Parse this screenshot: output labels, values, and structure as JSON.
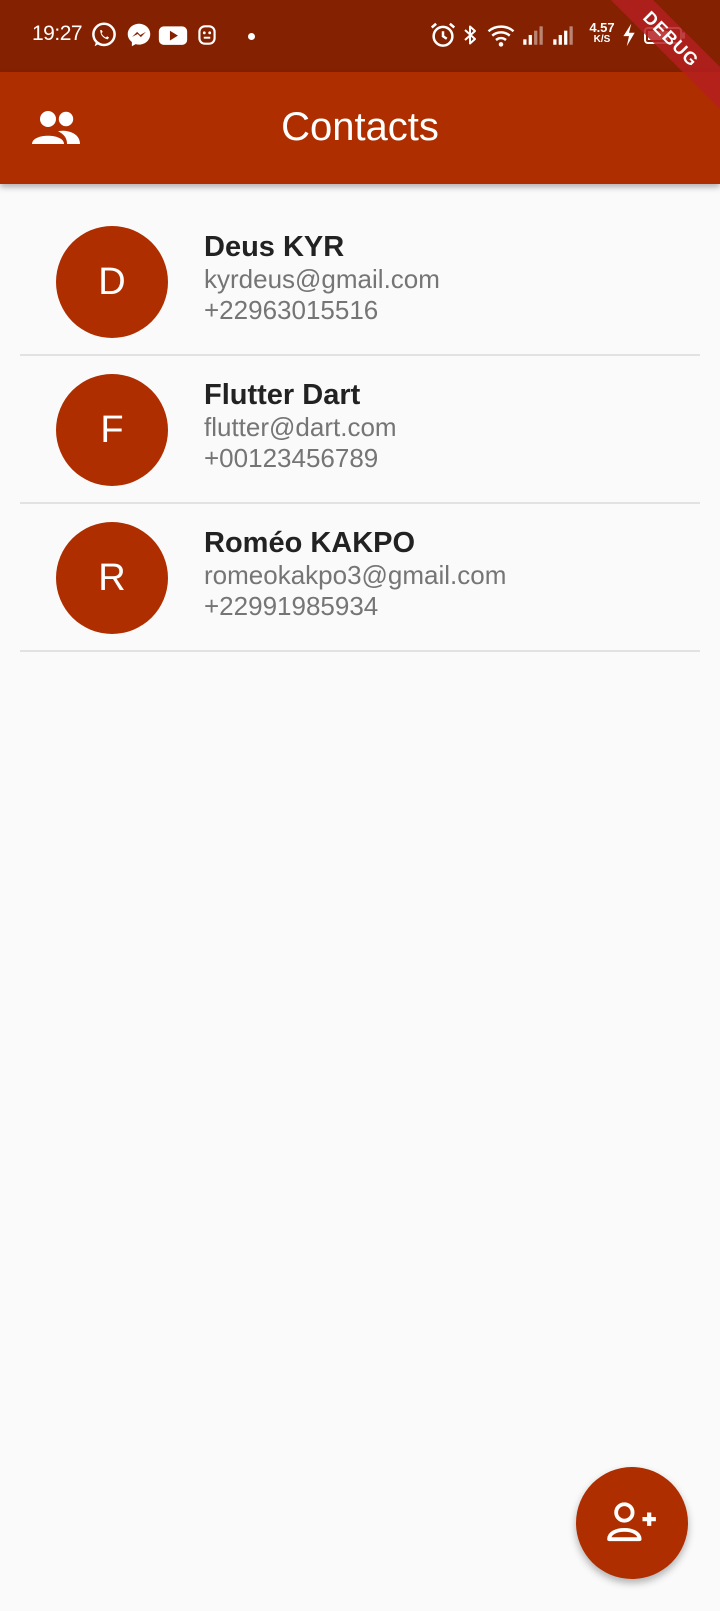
{
  "status_bar": {
    "time": "19:27",
    "left_icons": [
      "whatsapp-icon",
      "messenger-icon",
      "youtube-icon",
      "notification-app-icon"
    ],
    "right_icons": [
      "alarm-icon",
      "bluetooth-icon",
      "wifi-icon",
      "signal-icon",
      "signal-icon",
      "charging-icon",
      "battery-icon"
    ],
    "net_speed": {
      "value": "4.57",
      "unit": "K/S"
    }
  },
  "debug_banner": "DEBUG",
  "app_bar": {
    "title": "Contacts",
    "leading_icon": "people-icon"
  },
  "contacts": [
    {
      "initial": "D",
      "name": "Deus KYR",
      "email": "kyrdeus@gmail.com",
      "phone": "+22963015516"
    },
    {
      "initial": "F",
      "name": "Flutter Dart",
      "email": "flutter@dart.com",
      "phone": "+00123456789"
    },
    {
      "initial": "R",
      "name": "Roméo KAKPO",
      "email": "romeokakpo3@gmail.com",
      "phone": "+22991985934"
    }
  ],
  "fab": {
    "icon": "add-contact-icon"
  },
  "colors": {
    "status_bar": "#842100",
    "primary": "#ae2e00",
    "background": "#fafafa",
    "name_text": "#222222",
    "secondary_text": "#757575",
    "divider": "#e2e2e2"
  }
}
